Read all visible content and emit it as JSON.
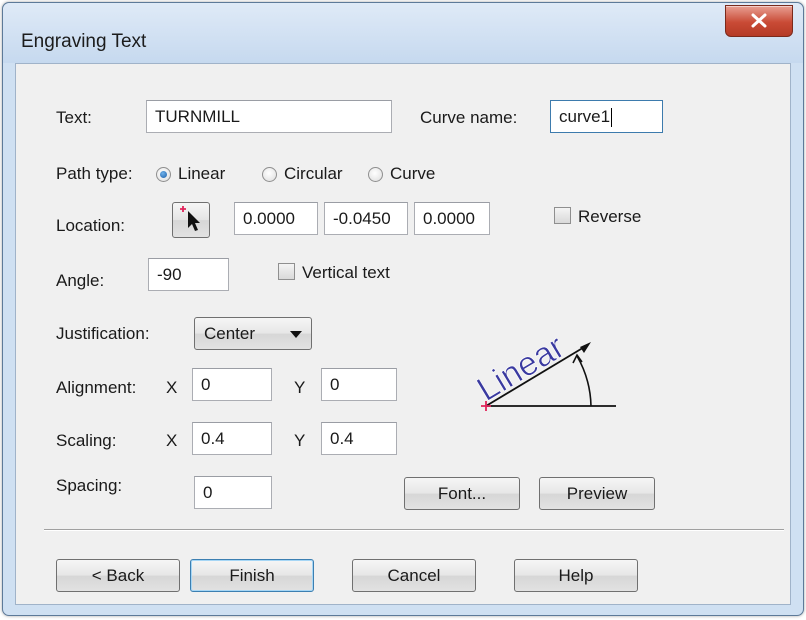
{
  "window": {
    "title": "Engraving Text"
  },
  "form": {
    "text_label": "Text:",
    "text_value": "TURNMILL",
    "curve_name_label": "Curve name:",
    "curve_name_value": "curve1",
    "path_type_label": "Path type:",
    "path_types": [
      {
        "label": "Linear",
        "selected": true
      },
      {
        "label": "Circular",
        "selected": false
      },
      {
        "label": "Curve",
        "selected": false
      }
    ],
    "location_label": "Location:",
    "location_values": [
      "0.0000",
      "-0.0450",
      "0.0000"
    ],
    "reverse_label": "Reverse",
    "reverse_checked": false,
    "angle_label": "Angle:",
    "angle_value": "-90",
    "vertical_text_label": "Vertical text",
    "vertical_text_checked": false,
    "justification_label": "Justification:",
    "justification_value": "Center",
    "alignment_label": "Alignment:",
    "alignment_x_label": "X",
    "alignment_x": "0",
    "alignment_y_label": "Y",
    "alignment_y": "0",
    "scaling_label": "Scaling:",
    "scaling_x_label": "X",
    "scaling_x": "0.4",
    "scaling_y_label": "Y",
    "scaling_y": "0.4",
    "spacing_label": "Spacing:",
    "spacing_value": "0"
  },
  "preview_graphic": {
    "text": "Linear",
    "text_color": "#3a3aa0",
    "origin_color": "#e0245a"
  },
  "buttons": {
    "font": "Font...",
    "preview": "Preview",
    "back": "< Back",
    "finish": "Finish",
    "cancel": "Cancel",
    "help": "Help"
  },
  "colors": {
    "title_bar": "#cfe0f2",
    "close_button": "#c94a35",
    "dialog_bg": "#f0f0f0"
  }
}
